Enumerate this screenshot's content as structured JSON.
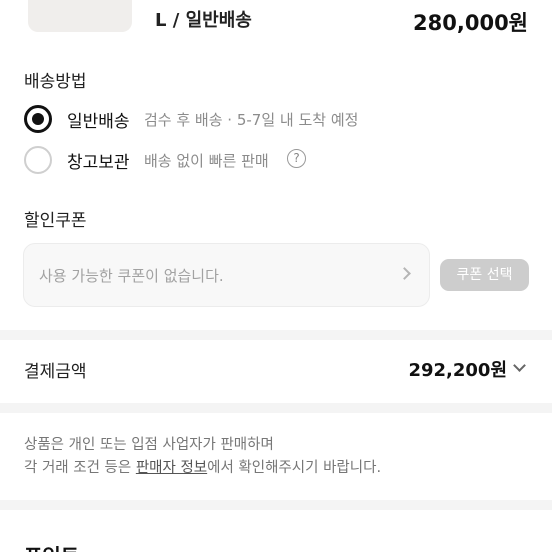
{
  "product": {
    "option": "L / 일반배송",
    "price": "280,000원"
  },
  "shipping": {
    "title": "배송방법",
    "options": [
      {
        "label": "일반배송",
        "description": "검수 후 배송 · 5-7일 내 도착 예정",
        "selected": true
      },
      {
        "label": "창고보관",
        "description": "배송 없이 빠른 판매",
        "selected": false
      }
    ],
    "help_icon": "?"
  },
  "coupon": {
    "title": "할인쿠폰",
    "placeholder": "사용 가능한 쿠폰이 없습니다.",
    "button_label": "쿠폰 선택"
  },
  "payment": {
    "label": "결제금액",
    "amount": "292,200원"
  },
  "notice": {
    "line1": "상품은 개인 또는 입점 사업자가 판매하며",
    "line2_prefix": "각 거래 조건 등은 ",
    "line2_link": "판매자 정보",
    "line2_suffix": "에서 확인해주시기 바랍니다."
  },
  "points": {
    "title": "포인트"
  },
  "colors": {
    "selected": "#111111",
    "button_disabled": "#cdcdcd",
    "divider": "#f4f4f4"
  }
}
